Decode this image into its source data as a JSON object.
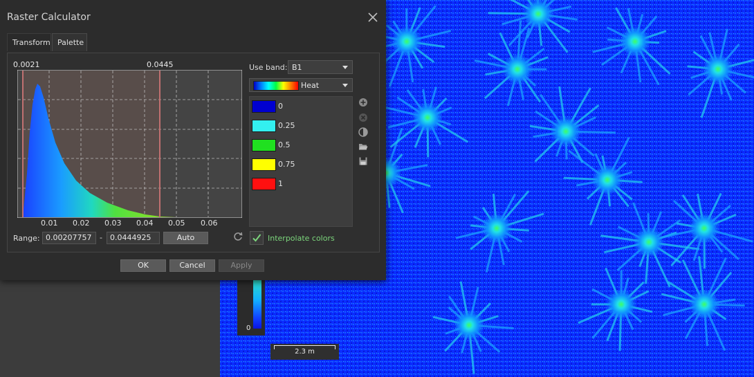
{
  "dialog": {
    "title": "Raster Calculator",
    "tabs": [
      {
        "label": "Transform"
      },
      {
        "label": "Palette"
      }
    ],
    "histogram": {
      "min_marker": "0.0021",
      "max_marker": "0.0445",
      "x_ticks": [
        "0.01",
        "0.02",
        "0.03",
        "0.04",
        "0.05",
        "0.06"
      ]
    },
    "range": {
      "label": "Range:",
      "min": "0.00207757",
      "separator": "-",
      "max": "0.0444925",
      "auto_label": "Auto"
    },
    "use_band": {
      "label": "Use band:",
      "value": "B1"
    },
    "palette": {
      "name": "Heat"
    },
    "stops": [
      {
        "value": "0",
        "color": "#0000d0"
      },
      {
        "value": "0.25",
        "color": "#33f0f0"
      },
      {
        "value": "0.5",
        "color": "#20e020"
      },
      {
        "value": "0.75",
        "color": "#ffff00"
      },
      {
        "value": "1",
        "color": "#ff1010"
      }
    ],
    "interpolate": {
      "label": "Interpolate colors",
      "checked": true
    },
    "buttons": {
      "ok": "OK",
      "cancel": "Cancel",
      "apply": "Apply"
    }
  },
  "map": {
    "legend_min": "0",
    "scale": "2.3 m"
  },
  "icons": [
    "close-icon",
    "add-icon",
    "remove-icon",
    "invert-icon",
    "open-folder-icon",
    "save-icon",
    "refresh-icon",
    "checkmark-icon",
    "dropdown-caret-icon"
  ]
}
